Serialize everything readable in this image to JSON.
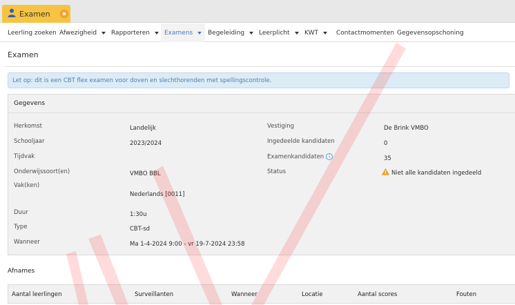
{
  "app_tab": {
    "label": "Examen",
    "icon": "user-icon"
  },
  "nav": {
    "items": [
      {
        "label": "Leerling zoeken",
        "dropdown": false
      },
      {
        "label": "Afwezigheid",
        "dropdown": true
      },
      {
        "label": "Rapporteren",
        "dropdown": true
      },
      {
        "label": "Examens",
        "dropdown": true,
        "active": true
      },
      {
        "label": "Begeleiding",
        "dropdown": true
      },
      {
        "label": "Leerplicht",
        "dropdown": true
      },
      {
        "label": "KWT",
        "dropdown": true
      },
      {
        "label": "Contactmomenten",
        "dropdown": false
      },
      {
        "label": "Gegevensopschoning",
        "dropdown": false
      }
    ]
  },
  "page": {
    "title": "Examen"
  },
  "banner": {
    "text": "Let op: dit is een CBT flex examen voor doven en slechthorenden met spellingscontrole."
  },
  "gegevens": {
    "title": "Gegevens",
    "left": [
      {
        "label": "Herkomst",
        "value": "Landelijk"
      },
      {
        "label": "Schooljaar",
        "value": "2023/2024"
      },
      {
        "label": "Tijdvak",
        "value": ""
      },
      {
        "label": "Onderwijssoort(en)",
        "value": "VMBO BBL"
      },
      {
        "label": "Vak(ken)",
        "value": "Nederlands [0011]"
      },
      {
        "label": "Duur",
        "value": "1:30u"
      },
      {
        "label": "Type",
        "value": "CBT-sd"
      },
      {
        "label": "Wanneer",
        "value": "Ma 1-4-2024 9:00 - vr 19-7-2024 23:58"
      }
    ],
    "right": [
      {
        "label": "Vestiging",
        "value": "De Brink VMBO"
      },
      {
        "label": "Ingedeelde kandidaten",
        "value": "0"
      },
      {
        "label": "Examenkandidaten",
        "value": "35"
      },
      {
        "label": "Status",
        "value": "Niet alle kandidaten ingedeeld"
      }
    ]
  },
  "afnames": {
    "title": "Afnames",
    "columns": [
      "Aantal leerlingen",
      "Surveillanten",
      "Wanneer",
      "Locatie",
      "Aantal scores",
      "Fouten"
    ]
  },
  "colors": {
    "tab_accent": "#f6c342",
    "nav_active": "#4a78c8",
    "banner_bg": "#dcecf7",
    "banner_text": "#4b7fae",
    "warning": "#f0a830",
    "watermark": "#ff0000"
  }
}
